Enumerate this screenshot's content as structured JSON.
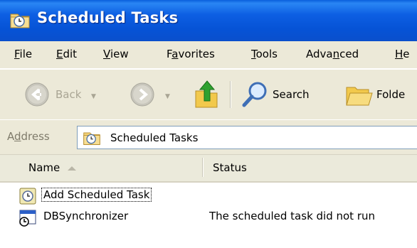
{
  "window": {
    "title": "Scheduled Tasks",
    "title_icon": "scheduled-tasks-folder-icon"
  },
  "menu": {
    "items": [
      {
        "label": "File",
        "accel": "F",
        "rest": "ile"
      },
      {
        "label": "Edit",
        "accel": "E",
        "rest": "dit"
      },
      {
        "label": "View",
        "accel": "V",
        "rest": "iew"
      },
      {
        "label": "Favorites",
        "pre": "F",
        "accel": "a",
        "rest": "vorites"
      },
      {
        "label": "Tools",
        "accel": "T",
        "rest": "ools"
      },
      {
        "label": "Advanced",
        "pre": "Adva",
        "accel": "n",
        "rest": "ced"
      },
      {
        "label": "He",
        "accel": "H",
        "rest": "e"
      }
    ]
  },
  "toolbar": {
    "back_label": "Back",
    "search_label": "Search",
    "folders_label": "Folde",
    "icons": [
      "back-icon",
      "forward-icon",
      "up-folder-icon",
      "search-icon",
      "folders-icon"
    ]
  },
  "address": {
    "label": "Address",
    "label_accel": "d",
    "value": "Scheduled Tasks"
  },
  "columns": {
    "name": "Name",
    "status": "Status"
  },
  "rows": [
    {
      "name": "Add Scheduled Task",
      "status": "",
      "icon": "add-scheduled-task-icon"
    },
    {
      "name": "DBSynchronizer",
      "status": "The scheduled task did not run",
      "icon": "scheduled-task-icon"
    }
  ],
  "colors": {
    "titlebar": "#0653d6",
    "chrome": "#ece9d8",
    "address_border": "#7f9db9"
  }
}
